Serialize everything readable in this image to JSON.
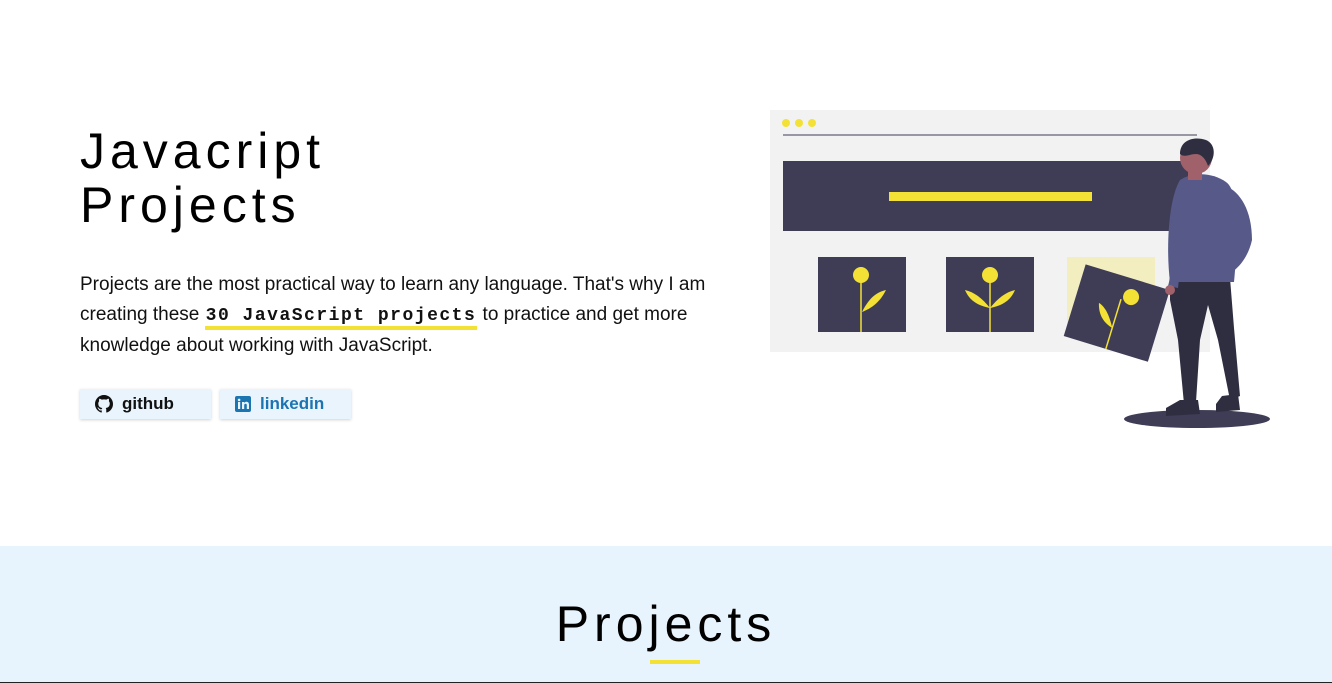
{
  "hero": {
    "title_line1": "Javacript",
    "title_line2": "Projects",
    "desc_part1": "Projects are the most practical way to learn any language. That's why I am creating these ",
    "desc_highlight": "30 JavaScript projects",
    "desc_part2": " to practice and get more knowledge about working with JavaScript."
  },
  "social": {
    "github_label": "github",
    "github_icon": "github-icon",
    "linkedin_label": "linkedin",
    "linkedin_icon": "linkedin-icon"
  },
  "projects": {
    "title": "Projects"
  },
  "colors": {
    "accent_yellow": "#f4e136",
    "dark_navy": "#3f3d56",
    "section_bg": "#e8f4fd",
    "linkedin_blue": "#1b75b1",
    "shirt_purple": "#575a89"
  }
}
